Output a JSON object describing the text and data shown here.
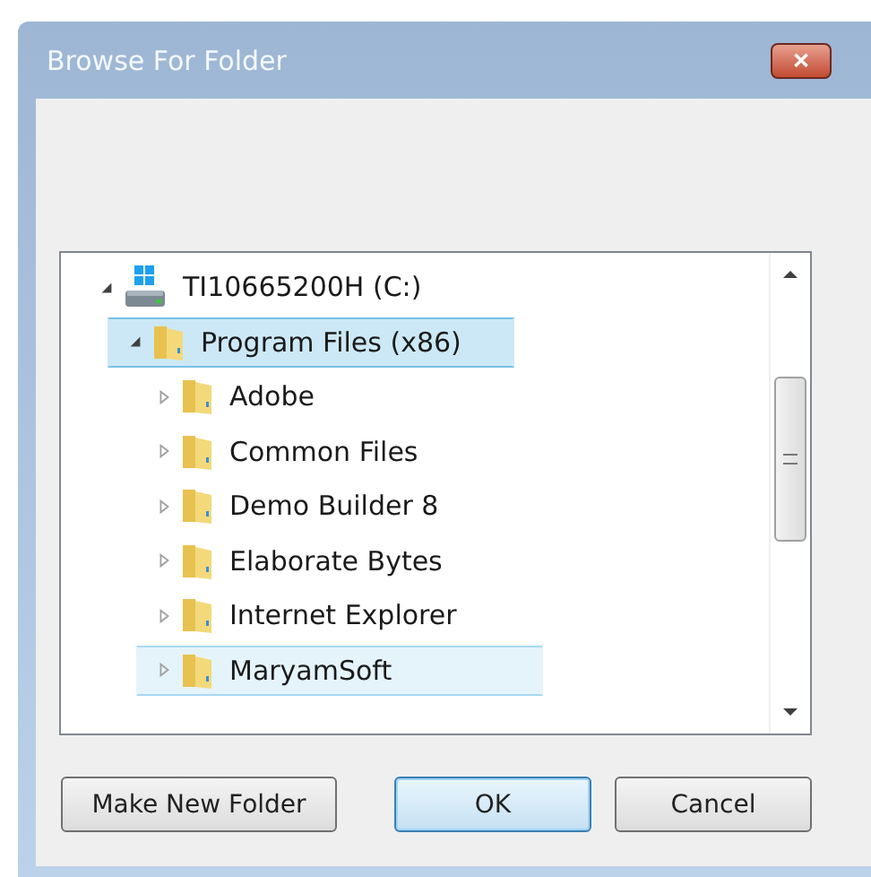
{
  "window": {
    "title": "Browse For Folder",
    "close_label": "✕"
  },
  "tree": {
    "items": [
      {
        "label": "TI10665200H (C:)",
        "kind": "drive",
        "expanded": true,
        "selected": false,
        "hovered": false,
        "children": [
          {
            "label": "Program Files (x86)",
            "kind": "folder",
            "expanded": true,
            "selected": true,
            "hovered": false,
            "children": [
              {
                "label": "Adobe",
                "kind": "folder",
                "expanded": false,
                "selected": false,
                "hovered": false
              },
              {
                "label": "Common Files",
                "kind": "folder",
                "expanded": false,
                "selected": false,
                "hovered": false
              },
              {
                "label": "Demo Builder 8",
                "kind": "folder",
                "expanded": false,
                "selected": false,
                "hovered": false
              },
              {
                "label": "Elaborate Bytes",
                "kind": "folder",
                "expanded": false,
                "selected": false,
                "hovered": false
              },
              {
                "label": "Internet Explorer",
                "kind": "folder",
                "expanded": false,
                "selected": false,
                "hovered": false
              },
              {
                "label": "MaryamSoft",
                "kind": "folder",
                "expanded": false,
                "selected": false,
                "hovered": true
              }
            ]
          }
        ]
      }
    ]
  },
  "buttons": [
    {
      "label": "Make New Folder",
      "default": false
    },
    {
      "label": "OK",
      "default": true
    },
    {
      "label": "Cancel",
      "default": false
    }
  ]
}
